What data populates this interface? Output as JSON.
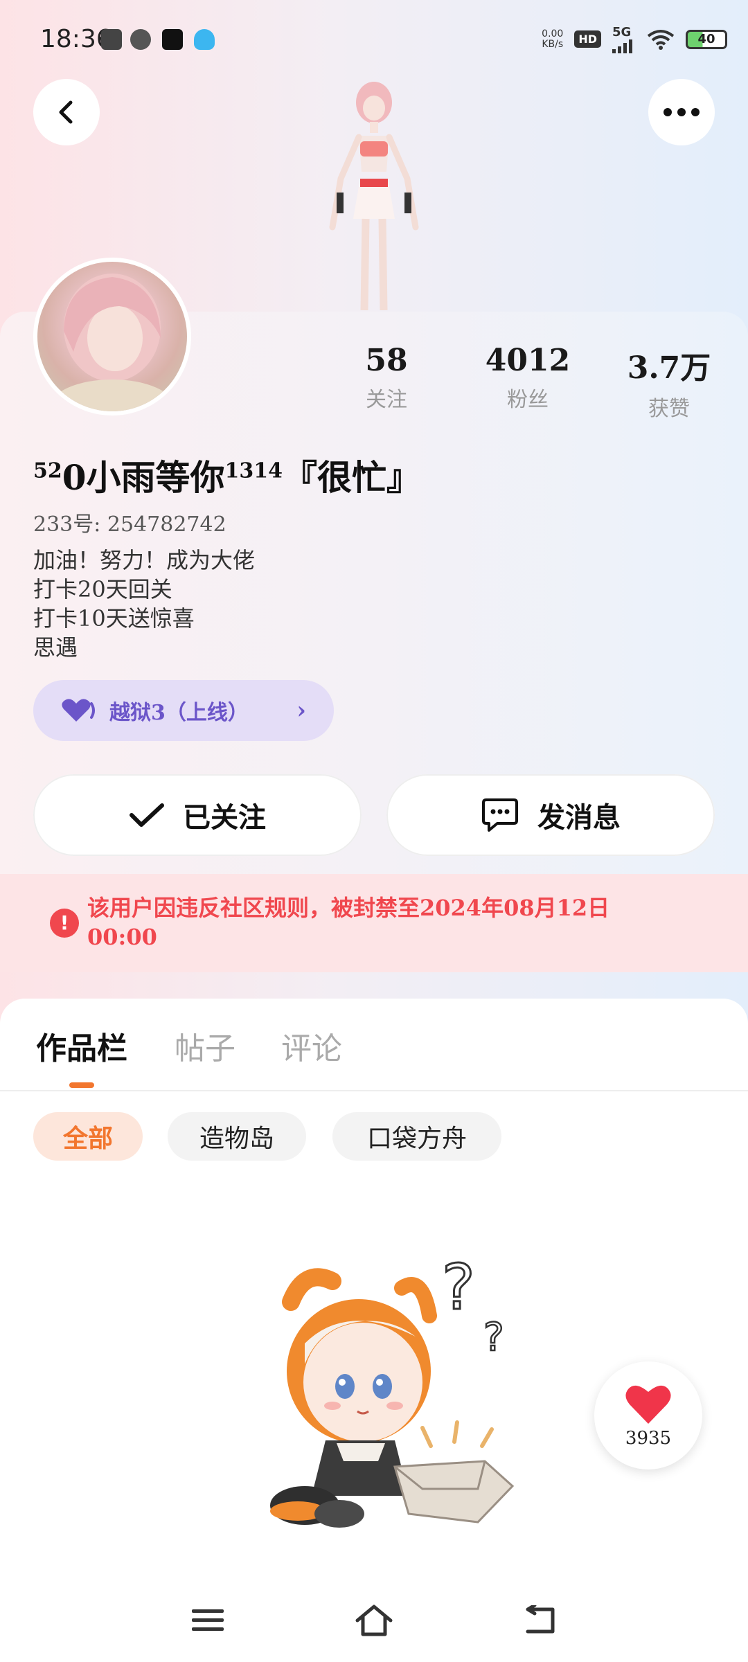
{
  "status_bar": {
    "time": "18:36",
    "net_speed_value": "0.00",
    "net_speed_unit": "KB/s",
    "hd_badge": "HD",
    "signal_label": "5G",
    "battery": "40"
  },
  "profile": {
    "nickname_pre": "5",
    "nickname_sup1": "2",
    "nickname_mid": "0小雨等你",
    "nickname_sup2": "1314",
    "nickname_tail": "『很忙』",
    "uid_label": "233号: 254782742",
    "bio": [
      "加油！努力！成为大佬",
      "打卡20天回关",
      "打卡10天送惊喜",
      "思遇"
    ],
    "game_chip": "越狱3（上线）",
    "stats": [
      {
        "value": "58",
        "label": "关注"
      },
      {
        "value": "4012",
        "label": "粉丝"
      },
      {
        "value": "3.7万",
        "label": "获赞"
      }
    ]
  },
  "actions": {
    "followed": "已关注",
    "message": "发消息"
  },
  "ban_notice": "该用户因违反社区规则，被封禁至2024年08月12日00:00",
  "tabs": [
    {
      "label": "作品栏",
      "active": true
    },
    {
      "label": "帖子",
      "active": false
    },
    {
      "label": "评论",
      "active": false
    }
  ],
  "filters": [
    {
      "label": "全部",
      "active": true
    },
    {
      "label": "造物岛",
      "active": false
    },
    {
      "label": "口袋方舟",
      "active": false
    }
  ],
  "like": {
    "count": "3935"
  },
  "colors": {
    "accent_orange": "#f2762e",
    "ban_red": "#f0474e",
    "chip_purple": "#6b55c9"
  }
}
